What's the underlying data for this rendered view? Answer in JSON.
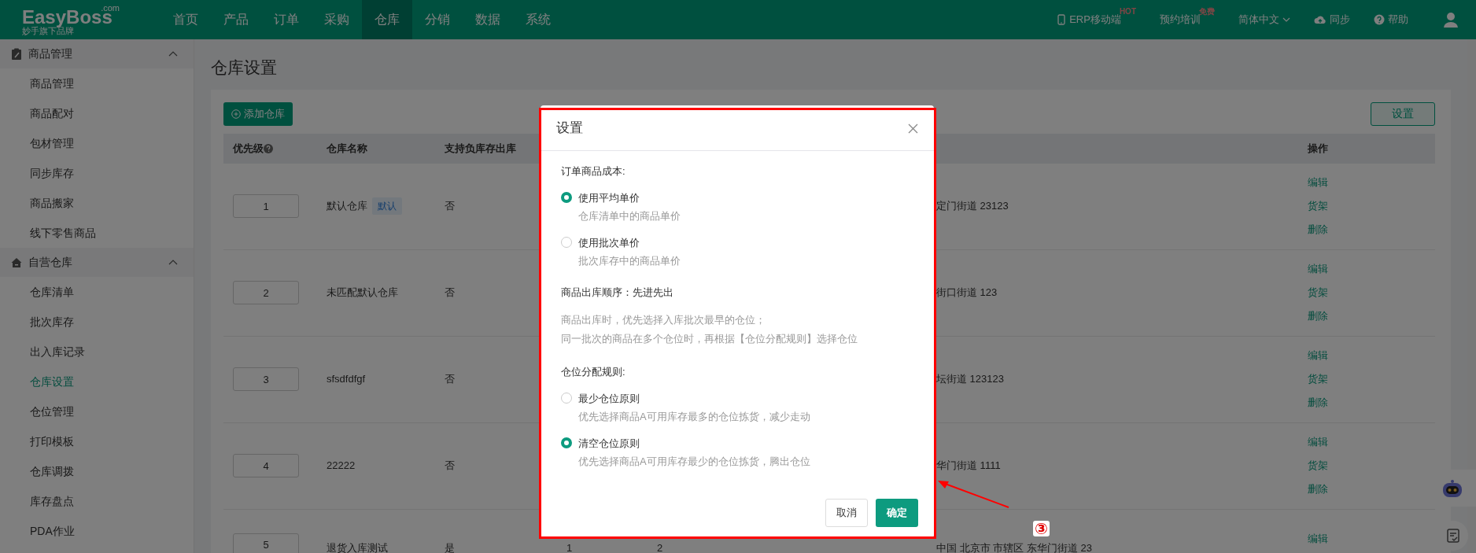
{
  "header": {
    "logo": "EasyBoss",
    "logo_suffix": ".com",
    "tagline": "妙手旗下品牌",
    "nav": [
      {
        "label": "首页",
        "selected": false
      },
      {
        "label": "产品",
        "selected": false
      },
      {
        "label": "订单",
        "selected": false
      },
      {
        "label": "采购",
        "selected": false
      },
      {
        "label": "仓库",
        "selected": true
      },
      {
        "label": "分销",
        "selected": false
      },
      {
        "label": "数据",
        "selected": false
      },
      {
        "label": "系统",
        "selected": false
      }
    ],
    "tools": [
      {
        "kind": "phone",
        "label": "ERP移动端",
        "badge": "HOT"
      },
      {
        "kind": "plain",
        "label": "预约培训",
        "badge": "免费"
      },
      {
        "kind": "dropdown",
        "label": "简体中文"
      },
      {
        "kind": "cloud",
        "label": "同步"
      },
      {
        "kind": "help",
        "label": "帮助"
      },
      {
        "kind": "user"
      }
    ]
  },
  "sidebar": {
    "groups": [
      {
        "title": "商品管理",
        "expanded": true,
        "items": [
          {
            "label": "商品管理",
            "selected": false
          },
          {
            "label": "商品配对",
            "selected": false
          },
          {
            "label": "包材管理",
            "selected": false
          },
          {
            "label": "同步库存",
            "selected": false
          },
          {
            "label": "商品搬家",
            "selected": false
          },
          {
            "label": "线下零售商品",
            "selected": false
          }
        ]
      },
      {
        "title": "自营仓库",
        "expanded": true,
        "items": [
          {
            "label": "仓库清单",
            "selected": false
          },
          {
            "label": "批次库存",
            "selected": false
          },
          {
            "label": "出入库记录",
            "selected": false
          },
          {
            "label": "仓库设置",
            "selected": true
          },
          {
            "label": "仓位管理",
            "selected": false
          },
          {
            "label": "打印模板",
            "selected": false
          },
          {
            "label": "仓库调拨",
            "selected": false
          },
          {
            "label": "库存盘点",
            "selected": false
          },
          {
            "label": "PDA作业",
            "selected": false
          }
        ]
      }
    ]
  },
  "page": {
    "title": "仓库设置",
    "add_button": "添加仓库",
    "settings_button": "设置",
    "table": {
      "columns": [
        "优先级",
        "仓库名称",
        "支持负库存出库",
        "操作"
      ],
      "rows": [
        {
          "priority": "1",
          "name": "默认仓库",
          "tag": "默认",
          "negative_stock": "否",
          "column_6": "定门街道 23123",
          "actions": [
            "编辑",
            "货架",
            "删除"
          ]
        },
        {
          "priority": "2",
          "name": "未匹配默认仓库",
          "negative_stock": "否",
          "column_6": "街口街道 123",
          "actions": [
            "编辑",
            "货架",
            "删除"
          ]
        },
        {
          "priority": "3",
          "name": "sfsdfdfgf",
          "negative_stock": "否",
          "column_6": "坛街道 123123",
          "actions": [
            "编辑",
            "货架",
            "删除"
          ]
        },
        {
          "priority": "4",
          "name": "22222",
          "negative_stock": "否",
          "column_6": "华门街道 1111",
          "actions": [
            "编辑",
            "货架",
            "删除"
          ]
        },
        {
          "priority": "5",
          "name": "退货入库测试",
          "negative_stock": "是",
          "column_4": "1",
          "column_5": "2",
          "column_6": "中国 北京市 市辖区 东华门街道 23",
          "actions": [
            "编辑"
          ]
        }
      ]
    }
  },
  "modal": {
    "title": "设置",
    "sections": [
      {
        "kind": "radio-group",
        "label": "订单商品成本:",
        "options": [
          {
            "label": "使用平均单价",
            "description": "仓库清单中的商品单价",
            "selected": true
          },
          {
            "label": "使用批次单价",
            "description": "批次库存中的商品单价",
            "selected": false
          }
        ]
      },
      {
        "kind": "info",
        "label": "商品出库顺序：先进先出",
        "lines": [
          "商品出库时，优先选择入库批次最早的仓位；",
          "同一批次的商品在多个仓位时，再根据【仓位分配规则】选择仓位"
        ]
      },
      {
        "kind": "radio-group",
        "label": "仓位分配规则:",
        "options": [
          {
            "label": "最少仓位原则",
            "description": "优先选择商品A可用库存最多的仓位拣货，减少走动",
            "selected": false
          },
          {
            "label": "清空仓位原则",
            "description": "优先选择商品A可用库存最少的仓位拣货，腾出仓位",
            "selected": true
          }
        ]
      }
    ],
    "buttons": [
      {
        "label": "取消",
        "kind": "secondary"
      },
      {
        "label": "确定",
        "kind": "primary"
      }
    ]
  },
  "annotation": {
    "marker": "③"
  }
}
